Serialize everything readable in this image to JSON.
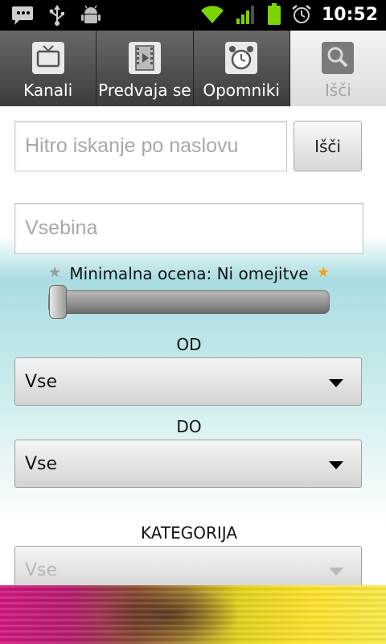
{
  "status_bar": {
    "icons_left": [
      "message-icon",
      "usb-icon",
      "android-debug-icon"
    ],
    "icons_right": [
      "wifi-icon",
      "signal-icon",
      "battery-icon",
      "alarm-icon"
    ],
    "time": "10:52"
  },
  "tabs": [
    {
      "label": "Kanali",
      "icon": "tv-icon",
      "selected": false
    },
    {
      "label": "Predvaja se",
      "icon": "film-icon",
      "selected": false
    },
    {
      "label": "Opomniki",
      "icon": "alarm-clock-icon",
      "selected": false
    },
    {
      "label": "Išči",
      "icon": "search-icon",
      "selected": true
    }
  ],
  "search": {
    "title_placeholder": "Hitro iskanje po naslovu",
    "search_button": "Išči",
    "content_placeholder": "Vsebina"
  },
  "rating": {
    "label": "Minimalna ocena: Ni omejitve",
    "slider_value_fraction": 0.0
  },
  "from": {
    "label": "OD",
    "selected": "Vse"
  },
  "to": {
    "label": "DO",
    "selected": "Vse"
  },
  "category": {
    "label": "KATEGORIJA",
    "selected": "Vse"
  },
  "colors": {
    "background_gradient": "#a9dde1",
    "star_off": "#9a9a9a",
    "star_on": "#f3a21b"
  }
}
